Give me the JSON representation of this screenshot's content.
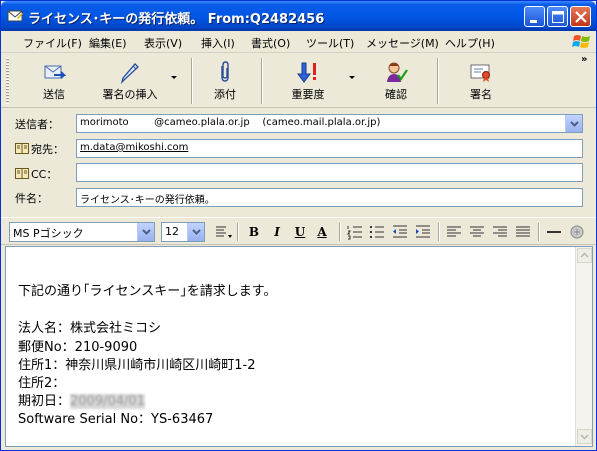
{
  "window": {
    "title": "ライセンス･キーの発行依頼。 From:Q2482456"
  },
  "menu": [
    "ファイル(F)",
    "編集(E)",
    "表示(V)",
    "挿入(I)",
    "書式(O)",
    "ツール(T)",
    "メッセージ(M)",
    "ヘルプ(H)"
  ],
  "toolbar": {
    "send": "送信",
    "insert_signature": "署名の挿入",
    "attach": "添付",
    "priority": "重要度",
    "check": "確認",
    "sign": "署名",
    "more": "»"
  },
  "headers": {
    "from_label": "送信者：",
    "from_value": "morimoto        @cameo.plala.or.jp    (cameo.mail.plala.or.jp)",
    "to_label": "宛先：",
    "to_value": "m.data@mikoshi.com",
    "cc_label": "CC：",
    "cc_value": "",
    "subject_label": "件名：",
    "subject_value": "ライセンス･キーの発行依頼。"
  },
  "format": {
    "font": "MS Pゴシック",
    "size": "12",
    "bold": "B",
    "italic": "I",
    "underline": "U",
    "font_color": "A"
  },
  "body": {
    "line1": "下記の通り｢ライセンスキー｣を請求します。",
    "line2": "法人名：株式会社ミコシ",
    "line3": "郵便No：210-9090",
    "line4": "住所1：神奈川県川崎市川崎区川崎町1-2",
    "line5": "住所2：",
    "line6_label": "期初日：",
    "line6_value": "2009/04/01",
    "line7": "Software Serial No：YS-63467"
  }
}
